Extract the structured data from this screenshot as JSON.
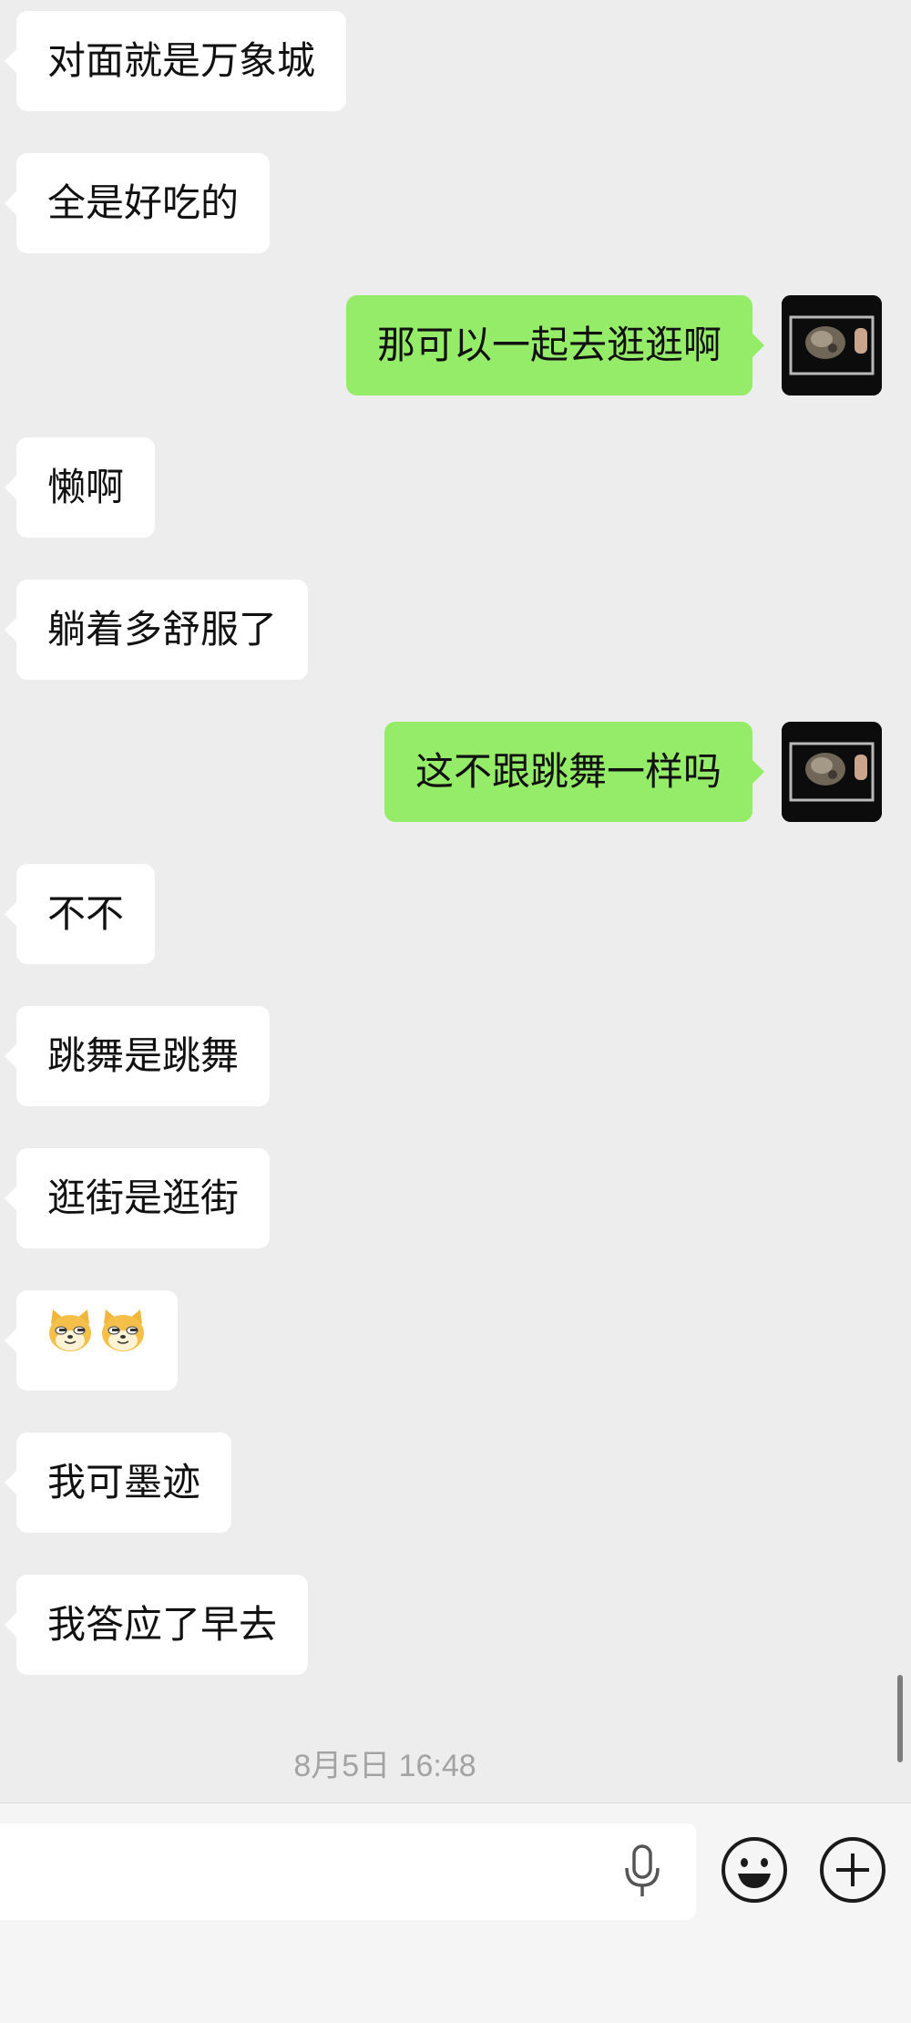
{
  "conversation": {
    "messages": [
      {
        "direction": "in",
        "text": "对面就是万象城"
      },
      {
        "direction": "in",
        "text": "全是好吃的"
      },
      {
        "direction": "out",
        "text": "那可以一起去逛逛啊"
      },
      {
        "direction": "in",
        "text": "懒啊"
      },
      {
        "direction": "in",
        "text": "躺着多舒服了"
      },
      {
        "direction": "out",
        "text": "这不跟跳舞一样吗"
      },
      {
        "direction": "in",
        "text": "不不"
      },
      {
        "direction": "in",
        "text": "跳舞是跳舞"
      },
      {
        "direction": "in",
        "text": "逛街是逛街"
      },
      {
        "direction": "in",
        "type": "emoji",
        "emoji": [
          "doge-emoji",
          "doge-emoji"
        ]
      },
      {
        "direction": "in",
        "text": "我可墨迹"
      },
      {
        "direction": "in",
        "text": "我答应了早去"
      }
    ],
    "timestamp": "8月5日 16:48"
  },
  "composer": {
    "input_value": "",
    "icons": [
      "microphone-icon",
      "emoji-face-icon",
      "plus-circle-icon"
    ]
  },
  "colors": {
    "background": "#ededed",
    "incoming_bubble": "#ffffff",
    "outgoing_bubble": "#95ec69"
  }
}
